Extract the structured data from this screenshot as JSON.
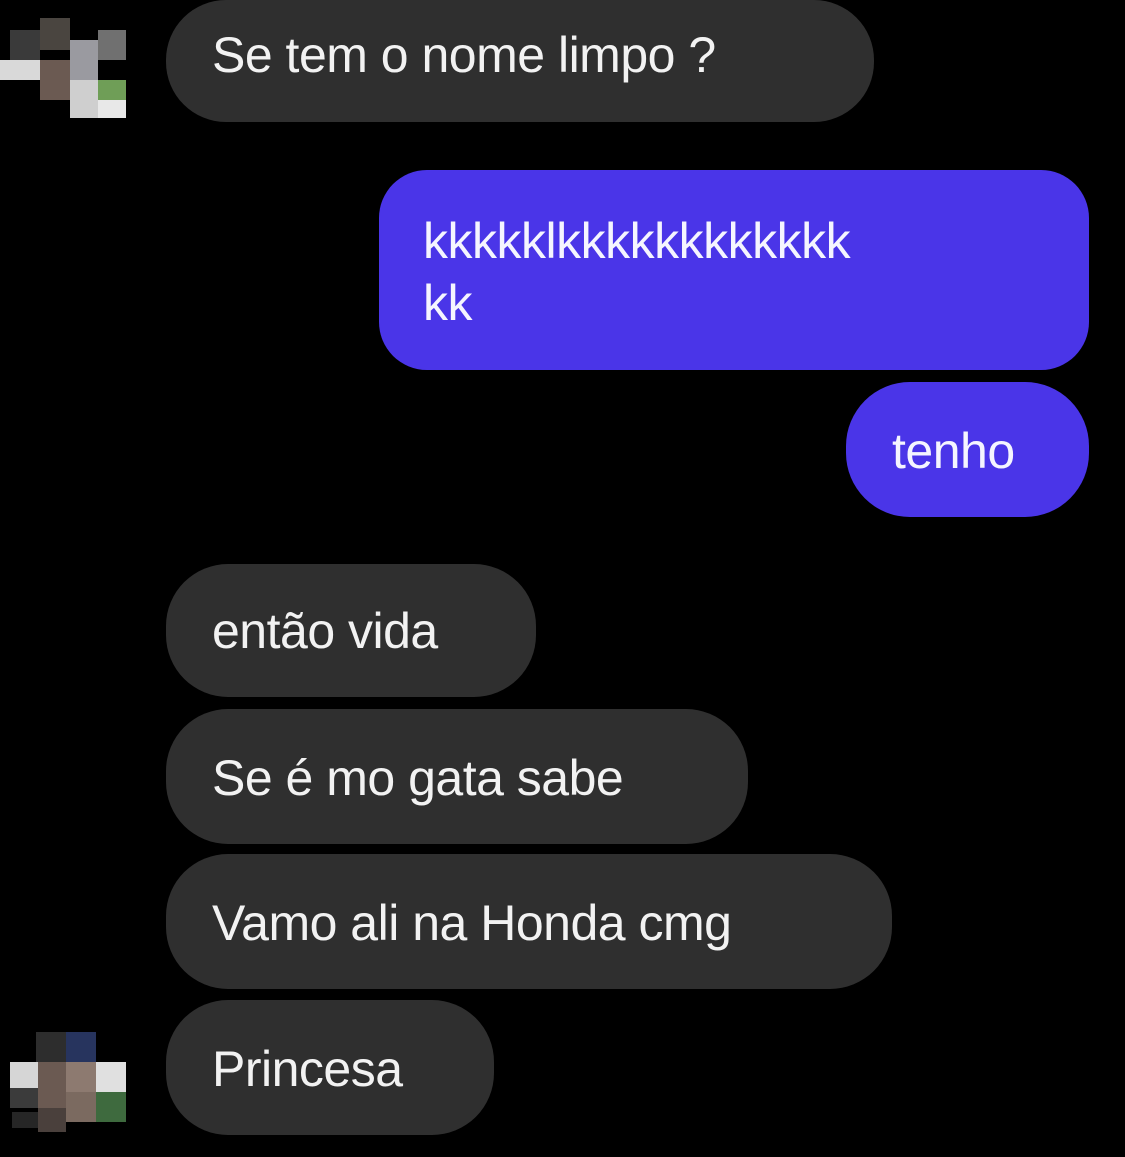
{
  "colors": {
    "background": "#000000",
    "incoming_bubble": "#2f2f2f",
    "outgoing_bubble": "#4a35e8",
    "text": "#f2f2f2"
  },
  "messages": [
    {
      "sender": "other",
      "text": "Se tem o nome limpo ?"
    },
    {
      "sender": "me",
      "text": "kkkkklkkkkkkkkkkkk\nkk"
    },
    {
      "sender": "me",
      "text": "tenho"
    },
    {
      "sender": "other",
      "text": "então vida"
    },
    {
      "sender": "other",
      "text": "Se é mo gata sabe"
    },
    {
      "sender": "other",
      "text": "Vamo ali na Honda cmg"
    },
    {
      "sender": "other",
      "text": "Princesa"
    }
  ],
  "avatars": [
    {
      "icon": "pixelated-avatar-icon"
    },
    {
      "icon": "pixelated-avatar-icon"
    }
  ]
}
